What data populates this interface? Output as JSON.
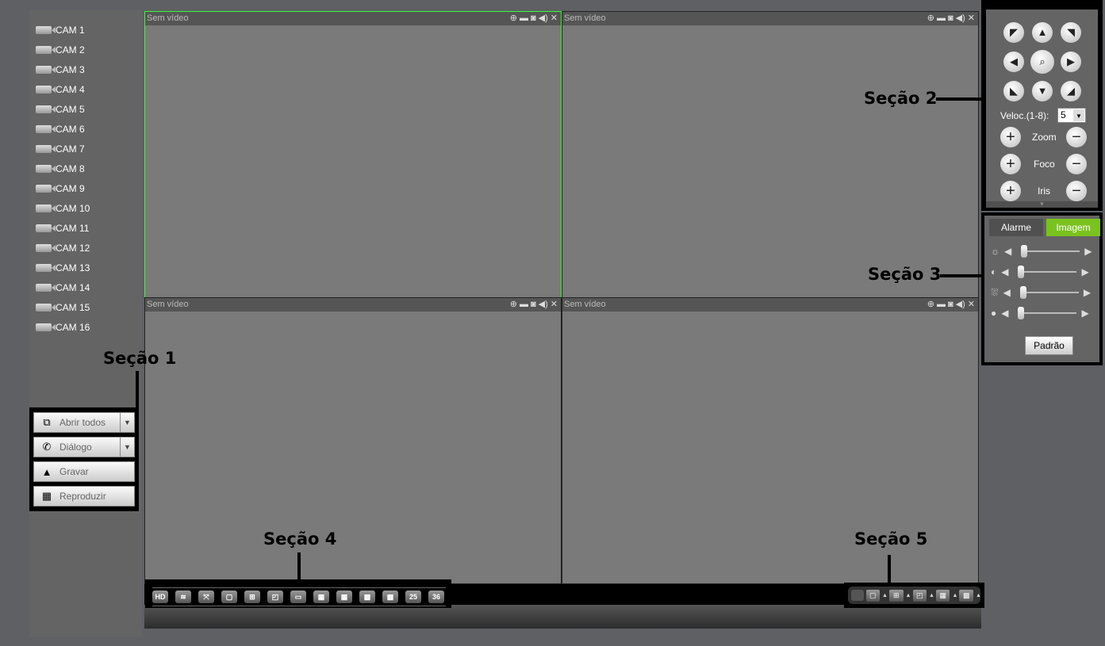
{
  "cameras": [
    "CAM 1",
    "CAM 2",
    "CAM 3",
    "CAM 4",
    "CAM 5",
    "CAM 6",
    "CAM 7",
    "CAM 8",
    "CAM 9",
    "CAM 10",
    "CAM 11",
    "CAM 12",
    "CAM 13",
    "CAM 14",
    "CAM 15",
    "CAM 16"
  ],
  "actions": {
    "open_all": "Abrir todos",
    "dialog": "Diálogo",
    "record": "Gravar",
    "playback": "Reproduzir"
  },
  "video": {
    "no_video": "Sem vídeo"
  },
  "layout_toolbar": [
    "HD",
    "≋",
    "⤧",
    "",
    "",
    "",
    "",
    "",
    "",
    "",
    "",
    "25",
    "36"
  ],
  "ptz": {
    "speed_label": "Veloc.(1-8):",
    "speed_value": "5",
    "zoom": "Zoom",
    "focus": "Foco",
    "iris": "Iris"
  },
  "image_panel": {
    "tabs": [
      "Alarme",
      "Imagem"
    ],
    "active_tab": "Imagem",
    "sliders": [
      {
        "name": "brightness",
        "value": 0
      },
      {
        "name": "contrast",
        "value": 0
      },
      {
        "name": "saturation",
        "value": 0
      },
      {
        "name": "hue",
        "value": 0
      }
    ],
    "default_button": "Padrão"
  },
  "annotations": [
    "Seção 1",
    "Seção 2",
    "Seção 3",
    "Seção 4",
    "Seção 5"
  ],
  "colors": {
    "active_tab": "#7ac21e",
    "selected_border": "#33ff33"
  }
}
